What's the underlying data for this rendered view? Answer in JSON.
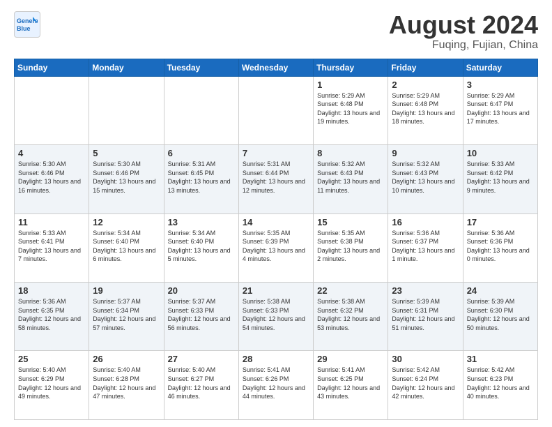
{
  "header": {
    "logo_line1": "General",
    "logo_line2": "Blue",
    "month_year": "August 2024",
    "location": "Fuqing, Fujian, China"
  },
  "weekdays": [
    "Sunday",
    "Monday",
    "Tuesday",
    "Wednesday",
    "Thursday",
    "Friday",
    "Saturday"
  ],
  "weeks": [
    [
      {
        "day": "",
        "info": ""
      },
      {
        "day": "",
        "info": ""
      },
      {
        "day": "",
        "info": ""
      },
      {
        "day": "",
        "info": ""
      },
      {
        "day": "1",
        "info": "Sunrise: 5:29 AM\nSunset: 6:48 PM\nDaylight: 13 hours\nand 19 minutes."
      },
      {
        "day": "2",
        "info": "Sunrise: 5:29 AM\nSunset: 6:48 PM\nDaylight: 13 hours\nand 18 minutes."
      },
      {
        "day": "3",
        "info": "Sunrise: 5:29 AM\nSunset: 6:47 PM\nDaylight: 13 hours\nand 17 minutes."
      }
    ],
    [
      {
        "day": "4",
        "info": "Sunrise: 5:30 AM\nSunset: 6:46 PM\nDaylight: 13 hours\nand 16 minutes."
      },
      {
        "day": "5",
        "info": "Sunrise: 5:30 AM\nSunset: 6:46 PM\nDaylight: 13 hours\nand 15 minutes."
      },
      {
        "day": "6",
        "info": "Sunrise: 5:31 AM\nSunset: 6:45 PM\nDaylight: 13 hours\nand 13 minutes."
      },
      {
        "day": "7",
        "info": "Sunrise: 5:31 AM\nSunset: 6:44 PM\nDaylight: 13 hours\nand 12 minutes."
      },
      {
        "day": "8",
        "info": "Sunrise: 5:32 AM\nSunset: 6:43 PM\nDaylight: 13 hours\nand 11 minutes."
      },
      {
        "day": "9",
        "info": "Sunrise: 5:32 AM\nSunset: 6:43 PM\nDaylight: 13 hours\nand 10 minutes."
      },
      {
        "day": "10",
        "info": "Sunrise: 5:33 AM\nSunset: 6:42 PM\nDaylight: 13 hours\nand 9 minutes."
      }
    ],
    [
      {
        "day": "11",
        "info": "Sunrise: 5:33 AM\nSunset: 6:41 PM\nDaylight: 13 hours\nand 7 minutes."
      },
      {
        "day": "12",
        "info": "Sunrise: 5:34 AM\nSunset: 6:40 PM\nDaylight: 13 hours\nand 6 minutes."
      },
      {
        "day": "13",
        "info": "Sunrise: 5:34 AM\nSunset: 6:40 PM\nDaylight: 13 hours\nand 5 minutes."
      },
      {
        "day": "14",
        "info": "Sunrise: 5:35 AM\nSunset: 6:39 PM\nDaylight: 13 hours\nand 4 minutes."
      },
      {
        "day": "15",
        "info": "Sunrise: 5:35 AM\nSunset: 6:38 PM\nDaylight: 13 hours\nand 2 minutes."
      },
      {
        "day": "16",
        "info": "Sunrise: 5:36 AM\nSunset: 6:37 PM\nDaylight: 13 hours\nand 1 minute."
      },
      {
        "day": "17",
        "info": "Sunrise: 5:36 AM\nSunset: 6:36 PM\nDaylight: 13 hours\nand 0 minutes."
      }
    ],
    [
      {
        "day": "18",
        "info": "Sunrise: 5:36 AM\nSunset: 6:35 PM\nDaylight: 12 hours\nand 58 minutes."
      },
      {
        "day": "19",
        "info": "Sunrise: 5:37 AM\nSunset: 6:34 PM\nDaylight: 12 hours\nand 57 minutes."
      },
      {
        "day": "20",
        "info": "Sunrise: 5:37 AM\nSunset: 6:33 PM\nDaylight: 12 hours\nand 56 minutes."
      },
      {
        "day": "21",
        "info": "Sunrise: 5:38 AM\nSunset: 6:33 PM\nDaylight: 12 hours\nand 54 minutes."
      },
      {
        "day": "22",
        "info": "Sunrise: 5:38 AM\nSunset: 6:32 PM\nDaylight: 12 hours\nand 53 minutes."
      },
      {
        "day": "23",
        "info": "Sunrise: 5:39 AM\nSunset: 6:31 PM\nDaylight: 12 hours\nand 51 minutes."
      },
      {
        "day": "24",
        "info": "Sunrise: 5:39 AM\nSunset: 6:30 PM\nDaylight: 12 hours\nand 50 minutes."
      }
    ],
    [
      {
        "day": "25",
        "info": "Sunrise: 5:40 AM\nSunset: 6:29 PM\nDaylight: 12 hours\nand 49 minutes."
      },
      {
        "day": "26",
        "info": "Sunrise: 5:40 AM\nSunset: 6:28 PM\nDaylight: 12 hours\nand 47 minutes."
      },
      {
        "day": "27",
        "info": "Sunrise: 5:40 AM\nSunset: 6:27 PM\nDaylight: 12 hours\nand 46 minutes."
      },
      {
        "day": "28",
        "info": "Sunrise: 5:41 AM\nSunset: 6:26 PM\nDaylight: 12 hours\nand 44 minutes."
      },
      {
        "day": "29",
        "info": "Sunrise: 5:41 AM\nSunset: 6:25 PM\nDaylight: 12 hours\nand 43 minutes."
      },
      {
        "day": "30",
        "info": "Sunrise: 5:42 AM\nSunset: 6:24 PM\nDaylight: 12 hours\nand 42 minutes."
      },
      {
        "day": "31",
        "info": "Sunrise: 5:42 AM\nSunset: 6:23 PM\nDaylight: 12 hours\nand 40 minutes."
      }
    ]
  ]
}
